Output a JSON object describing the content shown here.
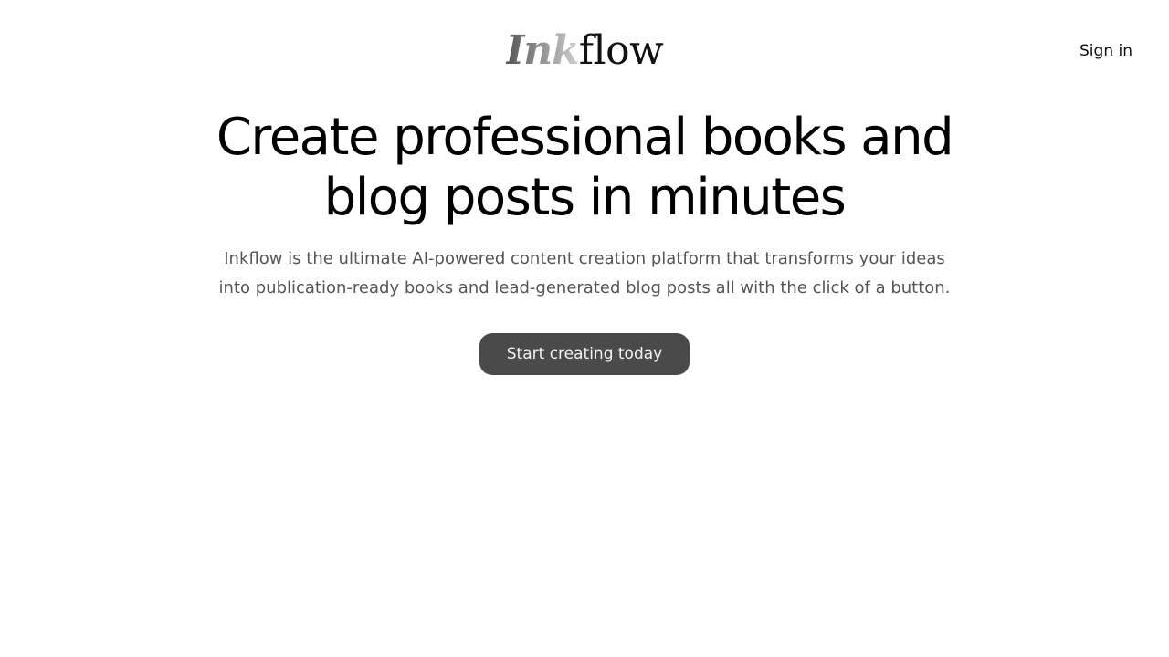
{
  "header": {
    "logo": {
      "part1": "Ink",
      "part2": "flow"
    },
    "signin_label": "Sign in"
  },
  "hero": {
    "headline": "Create professional books and blog posts in minutes",
    "subtext": "Inkflow is the ultimate AI-powered content creation platform that transforms your ideas into publication-ready books and lead-generated blog posts all with the click of a button.",
    "cta_label": "Start creating today"
  },
  "colors": {
    "background": "#ffffff",
    "text": "#000000",
    "muted_text": "#555555",
    "cta_background": "#4a4a4a",
    "cta_text": "#f2f2f2"
  }
}
